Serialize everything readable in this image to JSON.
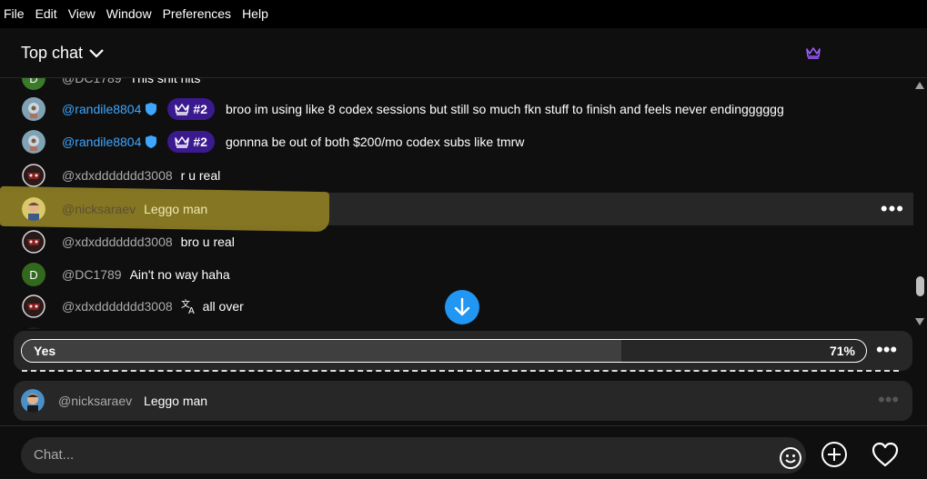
{
  "menu": [
    "File",
    "Edit",
    "View",
    "Window",
    "Preferences",
    "Help"
  ],
  "header": {
    "title": "Top chat",
    "accent": "#9b5cff"
  },
  "partial_top": {
    "author": "@DC1789",
    "text": "This shit hits"
  },
  "messages": [
    {
      "author": "@randile8804",
      "member": true,
      "rank": "#2",
      "text": "broo im using like 8 codex sessions but still so much fkn stuff to finish and feels never endingggggg",
      "avatar": "gear"
    },
    {
      "author": "@randile8804",
      "member": true,
      "rank": "#2",
      "text": "gonnna be out of both $200/mo codex subs like tmrw",
      "avatar": "gear"
    },
    {
      "author": "@xdxddddddd3008",
      "text": "r u real",
      "avatar": "dark"
    },
    {
      "author": "@nicksaraev",
      "text": "Leggo man",
      "avatar": "face",
      "highlight": true
    },
    {
      "author": "@xdxddddddd3008",
      "text": "bro u real",
      "avatar": "dark"
    },
    {
      "author": "@DC1789",
      "text": "Ain't no way haha",
      "avatar": "letter",
      "initial": "D"
    },
    {
      "author": "@xdxddddddd3008",
      "text": "all over",
      "avatar": "dark",
      "translate_icon": true
    }
  ],
  "poll": {
    "option": "Yes",
    "percent_label": "71%",
    "percent": 71
  },
  "pinned": {
    "author": "@nicksaraev",
    "text": "Leggo man"
  },
  "input": {
    "placeholder": "Chat..."
  },
  "colors": {
    "member_blue": "#3ea6ff",
    "rank_purple": "#3b1a8f",
    "jump_blue": "#2196f3",
    "highlighter": "#8a7a24"
  }
}
